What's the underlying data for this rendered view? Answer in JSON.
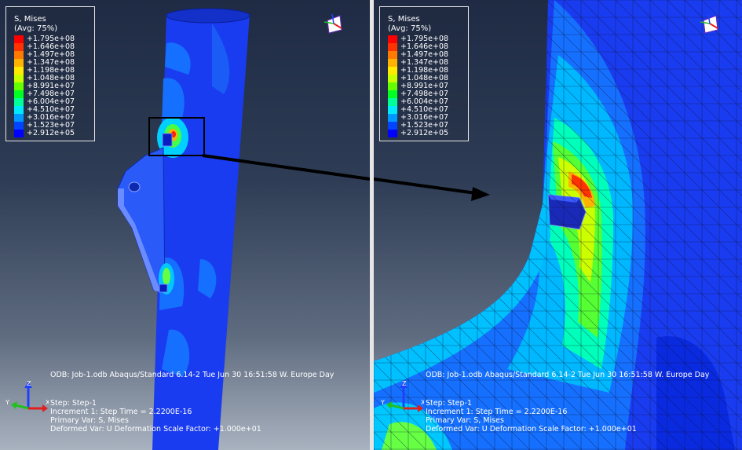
{
  "legend": {
    "title": "S, Mises",
    "subtitle": "(Avg: 75%)",
    "entries": [
      {
        "value": "+1.795e+08",
        "color": "#ff0000"
      },
      {
        "value": "+1.646e+08",
        "color": "#ff3300"
      },
      {
        "value": "+1.497e+08",
        "color": "#ff7a00"
      },
      {
        "value": "+1.347e+08",
        "color": "#ffb300"
      },
      {
        "value": "+1.198e+08",
        "color": "#ffea00"
      },
      {
        "value": "+1.048e+08",
        "color": "#c8ff00"
      },
      {
        "value": "+8.991e+07",
        "color": "#66ff00"
      },
      {
        "value": "+7.498e+07",
        "color": "#00ff22"
      },
      {
        "value": "+6.004e+07",
        "color": "#00ff99"
      },
      {
        "value": "+4.510e+07",
        "color": "#00eaff"
      },
      {
        "value": "+3.016e+07",
        "color": "#0099ff"
      },
      {
        "value": "+1.523e+07",
        "color": "#0044ff"
      },
      {
        "value": "+2.912e+05",
        "color": "#0000ff"
      }
    ]
  },
  "info": {
    "odb_line": "ODB: Job-1.odb    Abaqus/Standard 6.14-2    Tue Jun 30 16:51:58 W. Europe Day",
    "step_line": "Step: Step-1",
    "increment_line": "Increment      1: Step Time =    2.2200E-16",
    "primary_var_line": "Primary Var: S, Mises",
    "deformed_var_line": "Deformed Var: U   Deformation Scale Factor: +1.000e+01"
  },
  "triad": {
    "x": "X",
    "y": "Y",
    "z": "Z"
  },
  "colors": {
    "x_axis": "#e02020",
    "y_axis": "#20c020",
    "z_axis": "#2040ff",
    "separator": "#e6e6e6"
  }
}
